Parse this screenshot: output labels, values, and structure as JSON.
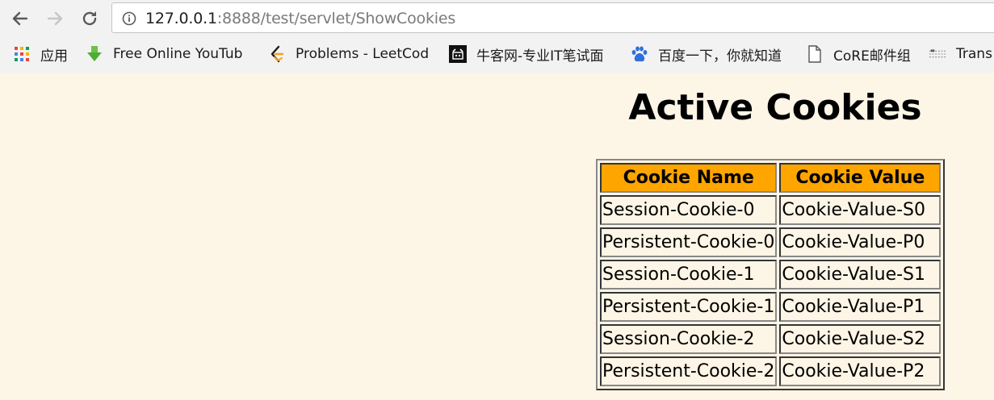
{
  "browser": {
    "url_host": "127.0.0.1",
    "url_rest": ":8888/test/servlet/ShowCookies",
    "bookmarks": [
      {
        "label": "应用",
        "icon": "apps-grid-icon"
      },
      {
        "label": "Free Online YouTub",
        "icon": "download-arrow-icon"
      },
      {
        "label": "Problems - LeetCod",
        "icon": "leetcode-icon"
      },
      {
        "label": "牛客网-专业IT笔试面",
        "icon": "nowcoder-icon"
      },
      {
        "label": "百度一下，你就知道",
        "icon": "baidu-paw-icon"
      },
      {
        "label": "CoRE邮件组",
        "icon": "page-icon"
      },
      {
        "label": "Trans",
        "icon": "translate-icon"
      }
    ]
  },
  "page": {
    "title": "Active Cookies",
    "table": {
      "headers": [
        "Cookie Name",
        "Cookie Value"
      ],
      "rows": [
        [
          "Session-Cookie-0",
          "Cookie-Value-S0"
        ],
        [
          "Persistent-Cookie-0",
          "Cookie-Value-P0"
        ],
        [
          "Session-Cookie-1",
          "Cookie-Value-S1"
        ],
        [
          "Persistent-Cookie-1",
          "Cookie-Value-P1"
        ],
        [
          "Session-Cookie-2",
          "Cookie-Value-S2"
        ],
        [
          "Persistent-Cookie-2",
          "Cookie-Value-P2"
        ]
      ]
    },
    "colors": {
      "background": "#fdf5e6",
      "header_bg": "#ffa500"
    }
  }
}
